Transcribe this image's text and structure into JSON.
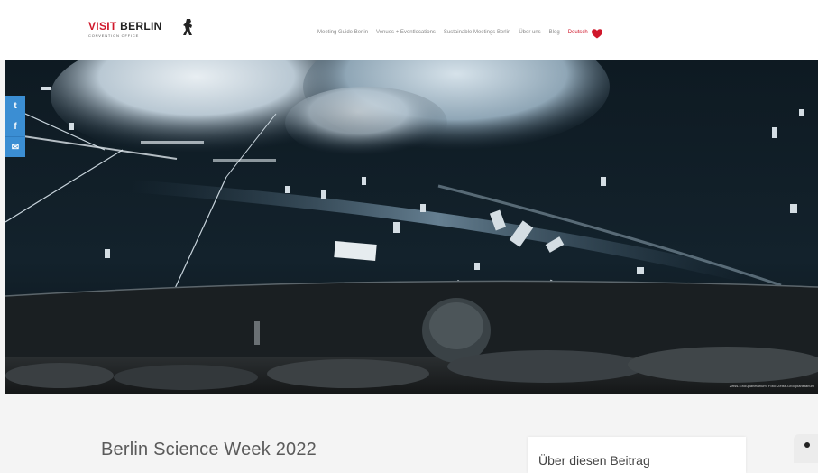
{
  "header": {
    "logo": {
      "main_visit": "VISIT",
      "main_berlin": "BERLIN",
      "sub": "CONVENTION OFFICE"
    },
    "nav": [
      "Meeting Guide Berlin",
      "Venues + Eventlocations",
      "Sustainable Meetings Berlin",
      "Über uns",
      "Blog"
    ],
    "language": "Deutsch",
    "heart_icon": "heart-icon",
    "colors": {
      "brand_red": "#d0172b",
      "nav_grey": "#8a8a8a"
    }
  },
  "hero": {
    "caption": "Zeiss-Großplanetarium, Foto: Zeiss-Großplanetarium"
  },
  "share": [
    {
      "icon": "twitter-icon",
      "glyph": "t"
    },
    {
      "icon": "facebook-icon",
      "glyph": "f"
    },
    {
      "icon": "email-icon",
      "glyph": "✉"
    }
  ],
  "main": {
    "title": "Berlin Science Week 2022"
  },
  "sidebar": {
    "title": "Über diesen Beitrag"
  }
}
